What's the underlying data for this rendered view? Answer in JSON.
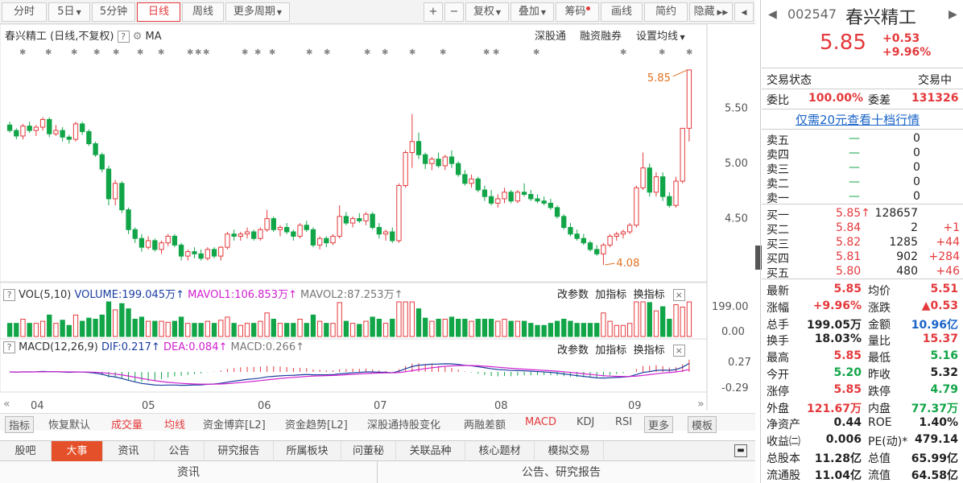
{
  "toolbar": {
    "tabs": [
      "分时",
      "5日",
      "5分钟",
      "日线",
      "周线",
      "更多周期"
    ],
    "tools": [
      "+",
      "−",
      "复权",
      "叠加",
      "筹码",
      "画线",
      "简约",
      "隐藏"
    ],
    "active": "日线"
  },
  "chart": {
    "title": "春兴精工 (日线,不复权)",
    "ma_label": "MA",
    "links": [
      "深股通",
      "融资融券",
      "设置均线"
    ],
    "y_ticks": [
      "5.50",
      "5.00",
      "4.50"
    ],
    "high_label": "5.85",
    "low_label": "4.08",
    "vol_header": {
      "name": "VOL(5,10)",
      "volume": "VOLUME:199.045万",
      "mavol1": "MAVOL1:106.853万",
      "mavol2": "MAVOL2:87.253万"
    },
    "vol_ticks": [
      "199.00",
      "0.00"
    ],
    "macd_header": {
      "name": "MACD(12,26,9)",
      "dif": "DIF:0.217",
      "dea": "DEA:0.084",
      "macd": "MACD:0.266"
    },
    "macd_ticks": [
      "0.27",
      "-0.29"
    ],
    "panel_links": [
      "改参数",
      "加指标",
      "换指标"
    ],
    "x_labels": [
      "04",
      "05",
      "06",
      "07",
      "08",
      "09"
    ]
  },
  "chart_data": {
    "type": "candlestick",
    "title": "",
    "ylim": [
      4.0,
      5.9
    ],
    "candles": [
      [
        5.35,
        5.38,
        5.28,
        5.3
      ],
      [
        5.3,
        5.32,
        5.22,
        5.25
      ],
      [
        5.25,
        5.36,
        5.22,
        5.34
      ],
      [
        5.34,
        5.38,
        5.28,
        5.3
      ],
      [
        5.3,
        5.35,
        5.25,
        5.33
      ],
      [
        5.33,
        5.42,
        5.3,
        5.4
      ],
      [
        5.4,
        5.42,
        5.24,
        5.27
      ],
      [
        5.27,
        5.35,
        5.25,
        5.3
      ],
      [
        5.3,
        5.33,
        5.2,
        5.24
      ],
      [
        5.24,
        5.26,
        5.18,
        5.22
      ],
      [
        5.22,
        5.38,
        5.2,
        5.36
      ],
      [
        5.36,
        5.38,
        5.26,
        5.29
      ],
      [
        5.29,
        5.31,
        5.16,
        5.18
      ],
      [
        5.18,
        5.2,
        5.06,
        5.08
      ],
      [
        5.08,
        5.1,
        4.92,
        4.95
      ],
      [
        4.95,
        4.98,
        4.62,
        4.68
      ],
      [
        4.68,
        4.85,
        4.62,
        4.82
      ],
      [
        4.82,
        4.84,
        4.55,
        4.58
      ],
      [
        4.58,
        4.6,
        4.36,
        4.4
      ],
      [
        4.4,
        4.42,
        4.28,
        4.32
      ],
      [
        4.32,
        4.36,
        4.2,
        4.24
      ],
      [
        4.24,
        4.34,
        4.22,
        4.3
      ],
      [
        4.3,
        4.32,
        4.2,
        4.22
      ],
      [
        4.22,
        4.3,
        4.18,
        4.28
      ],
      [
        4.28,
        4.36,
        4.25,
        4.34
      ],
      [
        4.34,
        4.36,
        4.24,
        4.26
      ],
      [
        4.26,
        4.28,
        4.12,
        4.16
      ],
      [
        4.16,
        4.22,
        4.12,
        4.2
      ],
      [
        4.2,
        4.24,
        4.14,
        4.18
      ],
      [
        4.18,
        4.22,
        4.12,
        4.14
      ],
      [
        4.14,
        4.24,
        4.12,
        4.22
      ],
      [
        4.22,
        4.24,
        4.14,
        4.16
      ],
      [
        4.16,
        4.25,
        4.12,
        4.24
      ],
      [
        4.24,
        4.38,
        4.22,
        4.36
      ],
      [
        4.36,
        4.4,
        4.3,
        4.34
      ],
      [
        4.34,
        4.38,
        4.3,
        4.36
      ],
      [
        4.36,
        4.42,
        4.32,
        4.38
      ],
      [
        4.38,
        4.4,
        4.3,
        4.32
      ],
      [
        4.32,
        4.42,
        4.3,
        4.4
      ],
      [
        4.4,
        4.58,
        4.38,
        4.5
      ],
      [
        4.5,
        4.52,
        4.38,
        4.4
      ],
      [
        4.4,
        4.44,
        4.34,
        4.42
      ],
      [
        4.42,
        4.46,
        4.36,
        4.38
      ],
      [
        4.38,
        4.4,
        4.3,
        4.34
      ],
      [
        4.34,
        4.46,
        4.32,
        4.44
      ],
      [
        4.44,
        4.48,
        4.38,
        4.4
      ],
      [
        4.4,
        4.42,
        4.24,
        4.26
      ],
      [
        4.26,
        4.34,
        4.22,
        4.32
      ],
      [
        4.32,
        4.34,
        4.24,
        4.28
      ],
      [
        4.28,
        4.36,
        4.26,
        4.34
      ],
      [
        4.34,
        4.62,
        4.32,
        4.52
      ],
      [
        4.52,
        4.56,
        4.44,
        4.46
      ],
      [
        4.46,
        4.52,
        4.42,
        4.5
      ],
      [
        4.5,
        4.55,
        4.46,
        4.48
      ],
      [
        4.48,
        4.56,
        4.44,
        4.54
      ],
      [
        4.54,
        4.56,
        4.4,
        4.42
      ],
      [
        4.42,
        4.46,
        4.32,
        4.36
      ],
      [
        4.36,
        4.4,
        4.3,
        4.38
      ],
      [
        4.38,
        4.42,
        4.28,
        4.3
      ],
      [
        4.3,
        4.82,
        4.28,
        4.8
      ],
      [
        4.8,
        5.12,
        4.78,
        5.1
      ],
      [
        5.1,
        5.45,
        4.96,
        5.2
      ],
      [
        5.2,
        5.28,
        5.04,
        5.08
      ],
      [
        5.08,
        5.1,
        4.95,
        5.0
      ],
      [
        5.0,
        5.06,
        4.94,
        5.04
      ],
      [
        5.04,
        5.1,
        4.96,
        4.98
      ],
      [
        4.98,
        5.08,
        4.94,
        5.06
      ],
      [
        5.06,
        5.12,
        4.96,
        5.0
      ],
      [
        5.0,
        5.02,
        4.88,
        4.9
      ],
      [
        4.9,
        4.94,
        4.8,
        4.82
      ],
      [
        4.82,
        4.9,
        4.78,
        4.86
      ],
      [
        4.86,
        4.88,
        4.74,
        4.76
      ],
      [
        4.76,
        4.8,
        4.66,
        4.7
      ],
      [
        4.7,
        4.76,
        4.62,
        4.64
      ],
      [
        4.64,
        4.72,
        4.6,
        4.68
      ],
      [
        4.68,
        4.78,
        4.64,
        4.74
      ],
      [
        4.74,
        4.76,
        4.64,
        4.66
      ],
      [
        4.66,
        4.76,
        4.64,
        4.74
      ],
      [
        4.74,
        4.82,
        4.7,
        4.72
      ],
      [
        4.72,
        4.76,
        4.66,
        4.68
      ],
      [
        4.68,
        4.72,
        4.64,
        4.66
      ],
      [
        4.66,
        4.7,
        4.62,
        4.64
      ],
      [
        4.64,
        4.68,
        4.58,
        4.6
      ],
      [
        4.6,
        4.62,
        4.5,
        4.52
      ],
      [
        4.52,
        4.54,
        4.4,
        4.42
      ],
      [
        4.42,
        4.46,
        4.34,
        4.36
      ],
      [
        4.36,
        4.4,
        4.3,
        4.32
      ],
      [
        4.32,
        4.36,
        4.26,
        4.28
      ],
      [
        4.28,
        4.3,
        4.2,
        4.22
      ],
      [
        4.22,
        4.26,
        4.16,
        4.18
      ],
      [
        4.18,
        4.28,
        4.08,
        4.26
      ],
      [
        4.26,
        4.36,
        4.24,
        4.34
      ],
      [
        4.34,
        4.38,
        4.3,
        4.36
      ],
      [
        4.36,
        4.4,
        4.32,
        4.38
      ],
      [
        4.38,
        4.46,
        4.36,
        4.44
      ],
      [
        4.44,
        4.8,
        4.42,
        4.78
      ],
      [
        4.78,
        5.1,
        4.76,
        4.96
      ],
      [
        4.96,
        5.0,
        4.7,
        4.74
      ],
      [
        4.74,
        4.92,
        4.7,
        4.88
      ],
      [
        4.88,
        4.92,
        4.66,
        4.7
      ],
      [
        4.7,
        4.74,
        4.6,
        4.62
      ],
      [
        4.62,
        4.88,
        4.6,
        4.84
      ],
      [
        4.84,
        5.32,
        4.82,
        5.32
      ],
      [
        5.32,
        5.85,
        5.2,
        5.85
      ]
    ],
    "volume_max": 199.0,
    "macd_range": [
      -0.29,
      0.27
    ]
  },
  "indicator_tabs": [
    "指标",
    "恢复默认",
    "成交量",
    "均线",
    "资金博弈[L2]",
    "资金趋势[L2]",
    "深股通持股变化",
    "两融差额",
    "MACD",
    "KDJ",
    "RSI",
    "更多",
    "模板"
  ],
  "bottom_tabs": [
    "股吧",
    "大事",
    "资讯",
    "公告",
    "研究报告",
    "所属板块",
    "问董秘",
    "关联品种",
    "核心题材",
    "模拟交易"
  ],
  "bottom_sub": [
    "资讯",
    "公告、研究报告"
  ],
  "quote": {
    "code": "002547",
    "name": "春兴精工",
    "price": "5.85",
    "change": "+0.53",
    "change_pct": "+9.96%",
    "status_label": "交易状态",
    "status_value": "交易中",
    "webi_label": "委比",
    "webi_value": "100.00%",
    "wecha_label": "委差",
    "wecha_value": "131326",
    "link_text": "仅需20元查看十档行情",
    "asks": [
      {
        "label": "卖五",
        "price": "—",
        "vol": "0"
      },
      {
        "label": "卖四",
        "price": "—",
        "vol": "0"
      },
      {
        "label": "卖三",
        "price": "—",
        "vol": "0"
      },
      {
        "label": "卖二",
        "price": "—",
        "vol": "0"
      },
      {
        "label": "卖一",
        "price": "—",
        "vol": "0"
      }
    ],
    "bids": [
      {
        "label": "买一",
        "price": "5.85↑",
        "vol": "128657",
        "delta": ""
      },
      {
        "label": "买二",
        "price": "5.84",
        "vol": "2",
        "delta": "+1"
      },
      {
        "label": "买三",
        "price": "5.82",
        "vol": "1285",
        "delta": "+44"
      },
      {
        "label": "买四",
        "price": "5.81",
        "vol": "902",
        "delta": "+284"
      },
      {
        "label": "买五",
        "price": "5.80",
        "vol": "480",
        "delta": "+46"
      }
    ],
    "stats": [
      {
        "l1": "最新",
        "v1": "5.85",
        "c1": "red",
        "l2": "均价",
        "v2": "5.51",
        "c2": "red"
      },
      {
        "l1": "涨幅",
        "v1": "+9.96%",
        "c1": "red",
        "l2": "涨跌",
        "v2": "▲0.53",
        "c2": "red"
      },
      {
        "l1": "总手",
        "v1": "199.05万",
        "c1": "",
        "l2": "金额",
        "v2": "10.96亿",
        "c2": "blue"
      },
      {
        "l1": "换手",
        "v1": "18.03%",
        "c1": "",
        "l2": "量比",
        "v2": "15.37",
        "c2": "red"
      },
      {
        "l1": "最高",
        "v1": "5.85",
        "c1": "red",
        "l2": "最低",
        "v2": "5.16",
        "c2": "green"
      },
      {
        "l1": "今开",
        "v1": "5.20",
        "c1": "green",
        "l2": "昨收",
        "v2": "5.32",
        "c2": ""
      },
      {
        "l1": "涨停",
        "v1": "5.85",
        "c1": "red",
        "l2": "跌停",
        "v2": "4.79",
        "c2": "green"
      },
      {
        "l1": "外盘",
        "v1": "121.67万",
        "c1": "red",
        "l2": "内盘",
        "v2": "77.37万",
        "c2": "green"
      },
      {
        "l1": "净资产",
        "v1": "0.44",
        "c1": "",
        "l2": "ROE",
        "v2": "1.40%",
        "c2": ""
      },
      {
        "l1": "收益㈡",
        "v1": "0.006",
        "c1": "",
        "l2": "PE(动)*",
        "v2": "479.14",
        "c2": ""
      },
      {
        "l1": "总股本",
        "v1": "11.28亿",
        "c1": "",
        "l2": "总值",
        "v2": "65.99亿",
        "c2": ""
      },
      {
        "l1": "流通股",
        "v1": "11.04亿",
        "c1": "",
        "l2": "流值",
        "v2": "64.58亿",
        "c2": ""
      }
    ]
  },
  "colors": {
    "up": "#e4393c",
    "down": "#11a548",
    "accent": "#e4502a"
  }
}
